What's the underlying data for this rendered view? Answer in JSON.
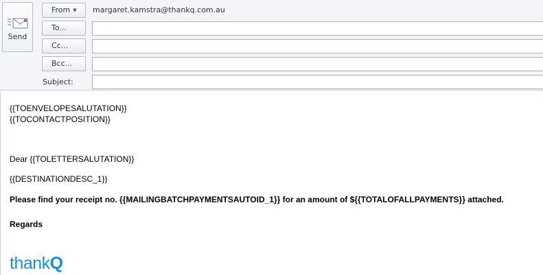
{
  "compose": {
    "send_label": "Send",
    "from_label": "From",
    "from_value": "margaret.kamstra@thankq.com.au",
    "to_label": "To...",
    "cc_label": "Cc...",
    "bcc_label": "Bcc...",
    "subject_label": "Subject:",
    "to_value": "",
    "cc_value": "",
    "bcc_value": "",
    "subject_value": ""
  },
  "body": {
    "line1": "{{TOENVELOPESALUTATION}}",
    "line2": "{{TOCONTACTPOSITION}}",
    "line3": "Dear {{TOLETTERSALUTATION}}",
    "line4": "{{DESTINATIONDESC_1}}",
    "line5": "Please find your receipt no. {{MAILINGBATCHPAYMENTSAUTOID_1}} for an amount of ${{TOTALOFALLPAYMENTS}} attached.",
    "line6": "Regards",
    "logo_text": "thank",
    "logo_mark": "Q"
  },
  "colors": {
    "logo": "#1a8fd8",
    "header_bg": "#f3f5f8"
  },
  "icons": {
    "send": "send-envelope-icon",
    "from_dropdown": "chevron-down-icon"
  }
}
